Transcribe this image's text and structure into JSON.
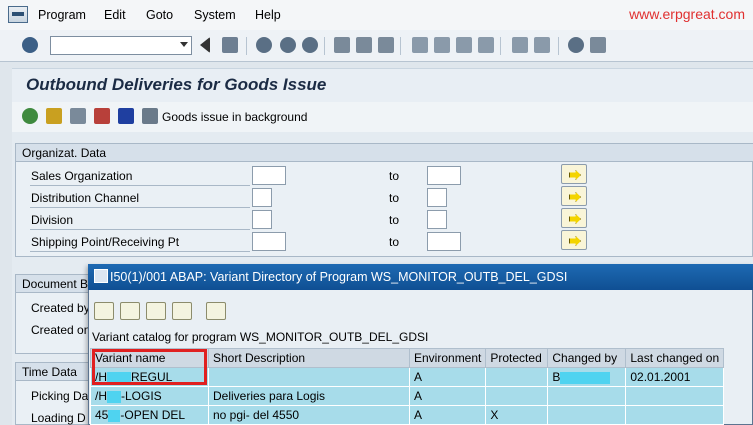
{
  "menu": {
    "items": [
      "Program",
      "Edit",
      "Goto",
      "System",
      "Help"
    ],
    "watermark": "www.erpgreat.com"
  },
  "toolbar": {
    "command_field_value": ""
  },
  "page": {
    "title": "Outbound Deliveries for Goods Issue",
    "app_toolbar_text": "Goods issue in background"
  },
  "org_group": {
    "title": "Organizat. Data",
    "rows": [
      {
        "label": "Sales Organization",
        "to": "to"
      },
      {
        "label": "Distribution Channel",
        "to": "to"
      },
      {
        "label": "Division",
        "to": "to"
      },
      {
        "label": "Shipping Point/Receiving Pt",
        "to": "to"
      }
    ]
  },
  "doc_group": {
    "title": "Document B",
    "rows": [
      "Created by",
      "Created on"
    ]
  },
  "time_group": {
    "title": "Time Data",
    "rows": [
      "Picking Da",
      "Loading D"
    ]
  },
  "dialog": {
    "title": "I50(1)/001 ABAP: Variant Directory of Program WS_MONITOR_OUTB_DEL_GDSI",
    "catalog_text": "Variant catalog for program WS_MONITOR_OUTB_DEL_GDSI",
    "columns": [
      "Variant name",
      "Short Description",
      "Environment",
      "Protected",
      "Changed by",
      "Last changed on"
    ],
    "rows": [
      {
        "variant": "/H",
        "variant_suffix": "REGUL",
        "desc": "",
        "env": "A",
        "protected": "",
        "changed_by": "B",
        "changed_on": "02.01.2001"
      },
      {
        "variant": "/H",
        "variant_suffix": "-LOGIS",
        "desc": "Deliveries para Logis",
        "env": "A",
        "protected": "",
        "changed_by": "",
        "changed_on": ""
      },
      {
        "variant": "45",
        "variant_suffix": "-OPEN DEL",
        "desc": "no pgi- del 4550",
        "env": "A",
        "protected": "X",
        "changed_by": "",
        "changed_on": ""
      }
    ]
  },
  "colors": {
    "title_bar": "#0f4f93",
    "highlight_box": "#e02020",
    "row_bg": "#a7dcea"
  }
}
